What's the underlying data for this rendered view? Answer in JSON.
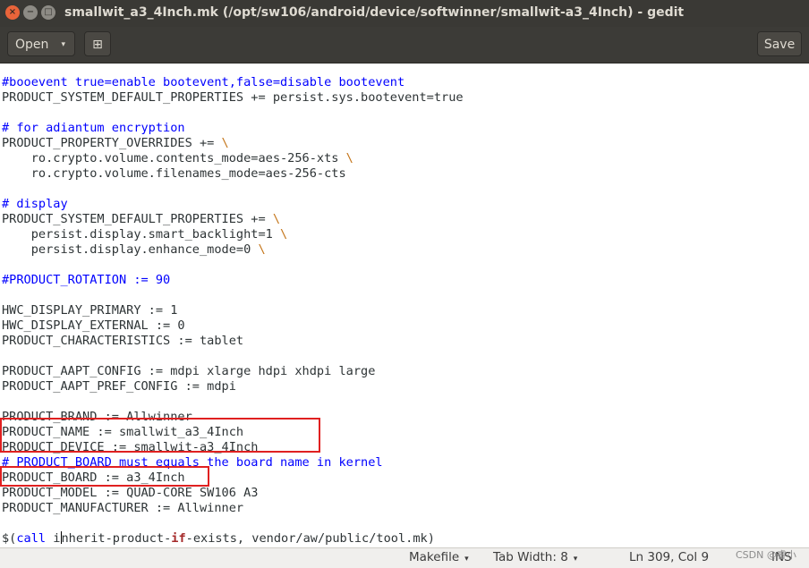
{
  "window": {
    "title": "smallwit_a3_4Inch.mk (/opt/sw106/android/device/softwinner/smallwit-a3_4Inch) - gedit",
    "close_glyph": "×",
    "minimize_glyph": "−",
    "maximize_glyph": "□"
  },
  "headerbar": {
    "open_label": "Open",
    "open_caret": "▾",
    "new_tab_glyph": "⊞",
    "save_label": "Save"
  },
  "editor": {
    "lines": [
      "#booevent true=enable bootevent,false=disable bootevent",
      "PRODUCT_SYSTEM_DEFAULT_PROPERTIES += persist.sys.bootevent=true",
      "",
      "# for adiantum encryption",
      "PRODUCT_PROPERTY_OVERRIDES += \\",
      "    ro.crypto.volume.contents_mode=aes-256-xts \\",
      "    ro.crypto.volume.filenames_mode=aes-256-cts",
      "",
      "# display",
      "PRODUCT_SYSTEM_DEFAULT_PROPERTIES += \\",
      "    persist.display.smart_backlight=1 \\",
      "    persist.display.enhance_mode=0 \\",
      "",
      "#PRODUCT_ROTATION := 90",
      "",
      "HWC_DISPLAY_PRIMARY := 1",
      "HWC_DISPLAY_EXTERNAL := 0",
      "PRODUCT_CHARACTERISTICS := tablet",
      "",
      "PRODUCT_AAPT_CONFIG := mdpi xlarge hdpi xhdpi large",
      "PRODUCT_AAPT_PREF_CONFIG := mdpi",
      "",
      "PRODUCT_BRAND := Allwinner",
      "PRODUCT_NAME := smallwit_a3_4Inch",
      "PRODUCT_DEVICE := smallwit-a3_4Inch",
      "# PRODUCT_BOARD must equals the board name in kernel",
      "PRODUCT_BOARD := a3_4Inch",
      "PRODUCT_MODEL := QUAD-CORE SW106 A3",
      "PRODUCT_MANUFACTURER := Allwinner",
      "",
      "$(call inherit-product-if-exists, vendor/aw/public/tool.mk)"
    ]
  },
  "statusbar": {
    "language": "Makefile",
    "tab_width": "Tab Width: 8",
    "position": "Ln 309, Col 9",
    "mode": "INS",
    "caret": "▾"
  },
  "watermark": "CSDN @睿小",
  "colors": {
    "titlebar_bg": "#3a3935",
    "headerbar_bg": "#3c3b37",
    "comment": "#0000ff",
    "backslash": "#c4751a",
    "keyword": "#a52a2a",
    "highlight_box": "#e02020"
  }
}
